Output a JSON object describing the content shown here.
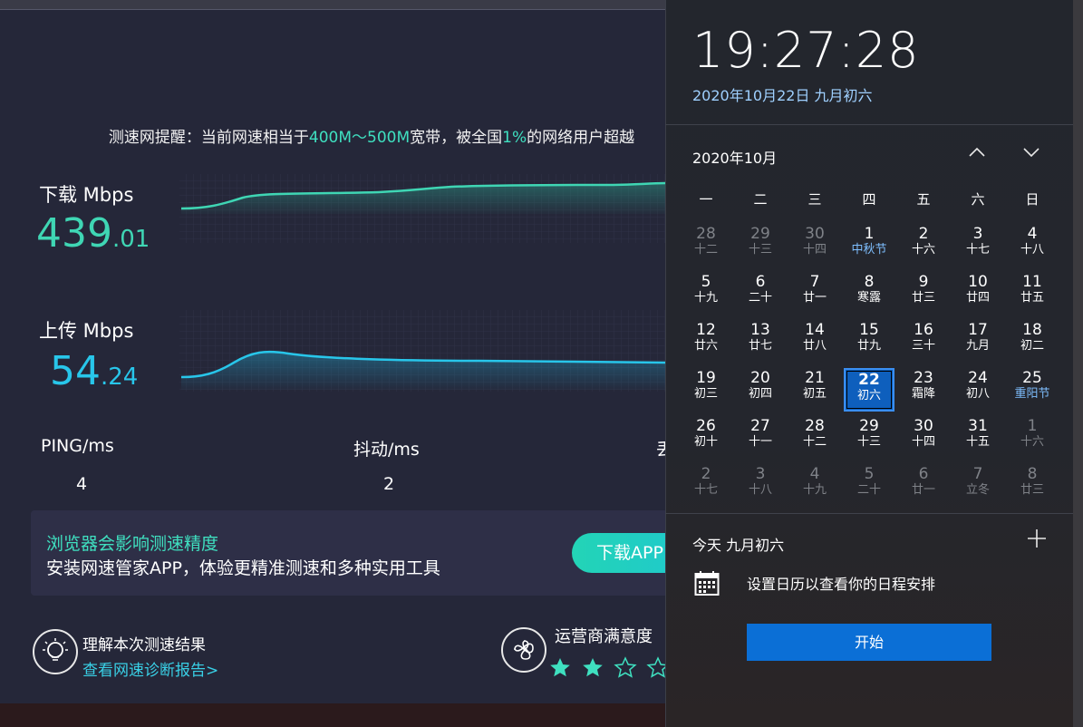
{
  "speedtest": {
    "tip": {
      "pre": "测速网提醒：当前网速相当于",
      "range": "400M～500M",
      "mid": "宽带，被全国",
      "pct": "1%",
      "post": "的网络用户超越"
    },
    "download": {
      "label": "下载 Mbps",
      "int": "439",
      "dec": ".01"
    },
    "upload": {
      "label": "上传 Mbps",
      "int": "54",
      "dec": ".24"
    },
    "ping": {
      "label": "PING/ms",
      "value": "4"
    },
    "jitter": {
      "label": "抖动/ms",
      "value": "2"
    },
    "loss": {
      "label": "丢"
    },
    "banner": {
      "title": "浏览器会影响测速精度",
      "subtitle": "安装网速管家APP，体验更精准测速和多种实用工具",
      "button": "下载APP"
    },
    "understand": {
      "title": "理解本次测速结果",
      "link": "查看网速诊断报告>"
    },
    "carrier": {
      "title": "运营商满意度",
      "stars": 2,
      "max_stars_visible": 4
    }
  },
  "calendar": {
    "time": "19:27:28",
    "date_line": "2020年10月22日 九月初六",
    "month_title": "2020年10月",
    "weekdays": [
      "一",
      "二",
      "三",
      "四",
      "五",
      "六",
      "日"
    ],
    "weeks": [
      [
        {
          "d": "28",
          "l": "十二",
          "o": true
        },
        {
          "d": "29",
          "l": "十三",
          "o": true
        },
        {
          "d": "30",
          "l": "十四",
          "o": true
        },
        {
          "d": "1",
          "l": "中秋节",
          "f": true
        },
        {
          "d": "2",
          "l": "十六"
        },
        {
          "d": "3",
          "l": "十七"
        },
        {
          "d": "4",
          "l": "十八"
        }
      ],
      [
        {
          "d": "5",
          "l": "十九"
        },
        {
          "d": "6",
          "l": "二十"
        },
        {
          "d": "7",
          "l": "廿一"
        },
        {
          "d": "8",
          "l": "寒露"
        },
        {
          "d": "9",
          "l": "廿三"
        },
        {
          "d": "10",
          "l": "廿四"
        },
        {
          "d": "11",
          "l": "廿五"
        }
      ],
      [
        {
          "d": "12",
          "l": "廿六"
        },
        {
          "d": "13",
          "l": "廿七"
        },
        {
          "d": "14",
          "l": "廿八"
        },
        {
          "d": "15",
          "l": "廿九"
        },
        {
          "d": "16",
          "l": "三十"
        },
        {
          "d": "17",
          "l": "九月"
        },
        {
          "d": "18",
          "l": "初二"
        }
      ],
      [
        {
          "d": "19",
          "l": "初三"
        },
        {
          "d": "20",
          "l": "初四"
        },
        {
          "d": "21",
          "l": "初五"
        },
        {
          "d": "22",
          "l": "初六",
          "s": true
        },
        {
          "d": "23",
          "l": "霜降"
        },
        {
          "d": "24",
          "l": "初八"
        },
        {
          "d": "25",
          "l": "重阳节",
          "f": true
        }
      ],
      [
        {
          "d": "26",
          "l": "初十"
        },
        {
          "d": "27",
          "l": "十一"
        },
        {
          "d": "28",
          "l": "十二"
        },
        {
          "d": "29",
          "l": "十三"
        },
        {
          "d": "30",
          "l": "十四"
        },
        {
          "d": "31",
          "l": "十五"
        },
        {
          "d": "1",
          "l": "十六",
          "o": true
        }
      ],
      [
        {
          "d": "2",
          "l": "十七",
          "o": true
        },
        {
          "d": "3",
          "l": "十八",
          "o": true
        },
        {
          "d": "4",
          "l": "十九",
          "o": true
        },
        {
          "d": "5",
          "l": "二十",
          "o": true
        },
        {
          "d": "6",
          "l": "廿一",
          "o": true
        },
        {
          "d": "7",
          "l": "立冬",
          "o": true
        },
        {
          "d": "8",
          "l": "廿三",
          "o": true
        }
      ]
    ],
    "today_label": "今天 九月初六",
    "schedule_text": "设置日历以查看你的日程安排",
    "start_button": "开始"
  }
}
